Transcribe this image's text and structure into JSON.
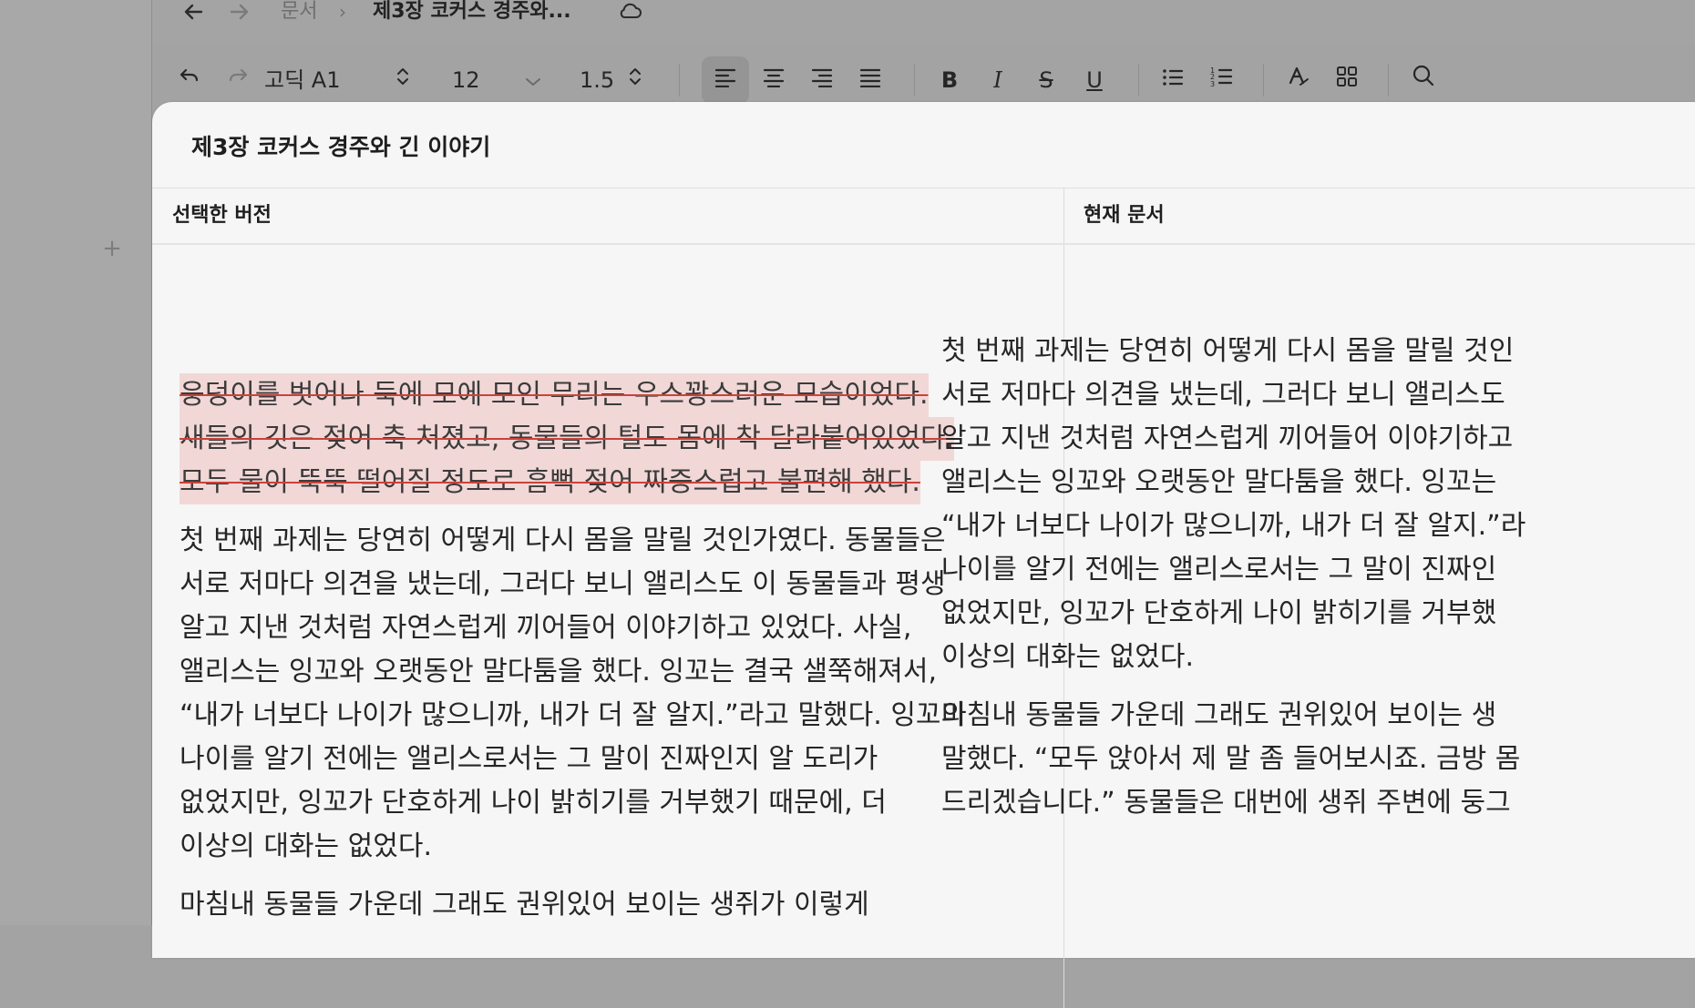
{
  "nav": {
    "back_icon": "arrow-left-icon",
    "forward_icon": "arrow-right-icon",
    "breadcrumb_root": "문서",
    "breadcrumb_sep": "›",
    "breadcrumb_current": "제3장 코커스 경주와...",
    "cloud_icon": "cloud-icon"
  },
  "toolbar": {
    "undo_icon": "undo-icon",
    "redo_icon": "redo-icon",
    "font": "고딕 A1",
    "size": "12",
    "line_height": "1.5",
    "align_left_active": true,
    "icons": [
      "align-left-icon",
      "align-center-icon",
      "align-right-icon",
      "align-justify-icon",
      "bold-icon",
      "italic-icon",
      "strikethrough-icon",
      "underline-icon",
      "bullet-list-icon",
      "numbered-list-icon",
      "clear-format-icon",
      "grid-icon",
      "search-icon"
    ]
  },
  "dialog": {
    "title": "제3장 코커스 경주와 긴 이야기",
    "left_header": "선택한 버전",
    "right_header": "현재 문서",
    "left": {
      "deleted_lines": [
        "웅덩이를 벗어나 둑에 모에 모인 무리는 우스꽝스러운 모습이었다.",
        "새들의 깃은 젖어 축 처졌고, 동물들의 털도 몸에 착 달라붙어있었다.",
        "모두 물이 뚝뚝 떨어질 정도로 흠뻑 젖어 짜증스럽고 불편해 했다."
      ],
      "para1": "첫 번째 과제는 당연히 어떻게 다시 몸을 말릴 것인가였다. 동물들은\n서로 저마다 의견을 냈는데, 그러다 보니 앨리스도 이 동물들과 평생\n알고 지낸 것처럼 자연스럽게 끼어들어 이야기하고 있었다. 사실,\n앨리스는 잉꼬와 오랫동안 말다툼을 했다. 잉꼬는 결국 샐쭉해져서,\n“내가 너보다 나이가 많으니까, 내가 더 잘 알지.”라고 말했다. 잉꼬의\n나이를 알기 전에는 앨리스로서는 그 말이 진짜인지 알 도리가\n없었지만, 잉꼬가 단호하게 나이 밝히기를 거부했기 때문에, 더\n이상의 대화는 없었다.",
      "para2": "마침내 동물들 가운데 그래도 권위있어 보이는 생쥐가 이렇게"
    },
    "right": {
      "para1": "첫 번째 과제는 당연히 어떻게 다시 몸을 말릴 것인\n서로 저마다 의견을 냈는데, 그러다 보니 앨리스도\n알고 지낸 것처럼 자연스럽게 끼어들어 이야기하고\n앨리스는 잉꼬와 오랫동안 말다툼을 했다. 잉꼬는\n“내가 너보다 나이가 많으니까, 내가 더 잘 알지.”라\n나이를 알기 전에는 앨리스로서는 그 말이 진짜인\n없었지만, 잉꼬가 단호하게 나이 밝히기를 거부했\n이상의 대화는 없었다.",
      "para2": "마침내 동물들 가운데 그래도 권위있어 보이는 생\n말했다. “모두 앉아서 제 말 좀 들어보시죠. 금방 몸\n드리겠습니다.” 동물들은 대번에 생쥐 주변에 둥그"
    }
  }
}
